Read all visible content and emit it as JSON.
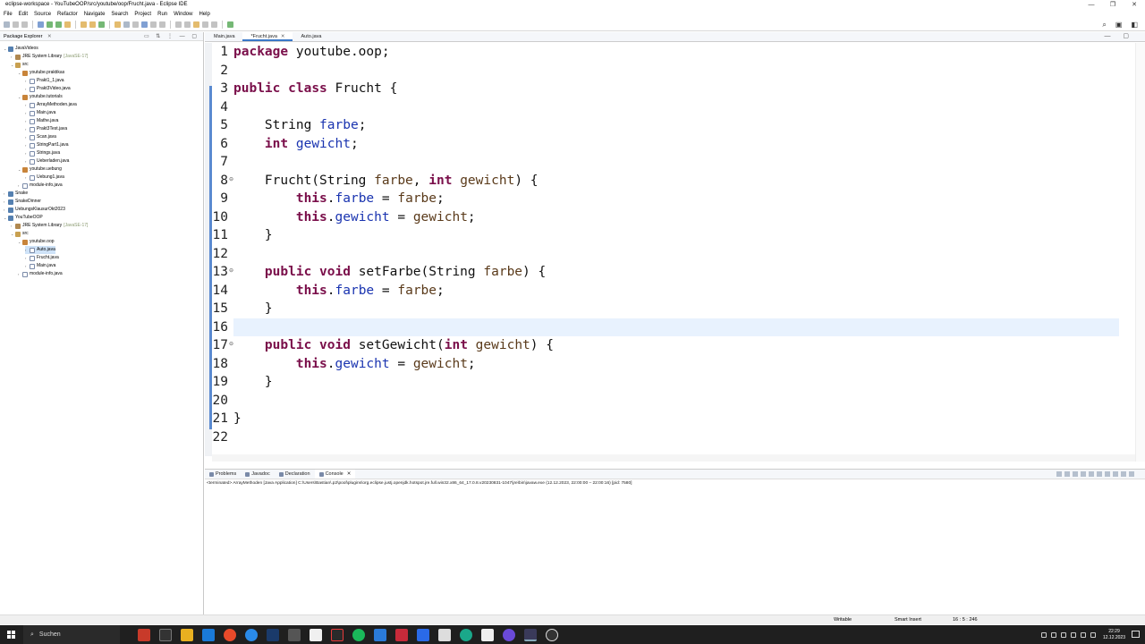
{
  "window": {
    "title": "eclipse-workspace - YouTubeOOP/src/youtube/oop/Frucht.java - Eclipse IDE"
  },
  "menu": [
    "File",
    "Edit",
    "Source",
    "Refactor",
    "Navigate",
    "Search",
    "Project",
    "Run",
    "Window",
    "Help"
  ],
  "package_explorer": {
    "title": "Package Explorer",
    "tree": [
      {
        "label": "JavaVideos",
        "depth": 0,
        "type": "proj",
        "twisty": "v"
      },
      {
        "label": "JRE System Library",
        "suffix": "[JavaSE-17]",
        "depth": 1,
        "type": "lib",
        "twisty": ">"
      },
      {
        "label": "src",
        "depth": 1,
        "type": "src",
        "twisty": "v"
      },
      {
        "label": "youtube.praktikas",
        "depth": 2,
        "type": "pkg",
        "twisty": "v"
      },
      {
        "label": "Prakt1_1.java",
        "depth": 3,
        "type": "java",
        "twisty": ">"
      },
      {
        "label": "Prakt3Video.java",
        "depth": 3,
        "type": "java",
        "twisty": ">"
      },
      {
        "label": "youtube.tutorials",
        "depth": 2,
        "type": "pkg",
        "twisty": "v"
      },
      {
        "label": "ArrayMethoden.java",
        "depth": 3,
        "type": "java",
        "twisty": ">"
      },
      {
        "label": "Main.java",
        "depth": 3,
        "type": "java",
        "twisty": ">"
      },
      {
        "label": "Mathe.java",
        "depth": 3,
        "type": "java",
        "twisty": ">"
      },
      {
        "label": "Prakt3Test.java",
        "depth": 3,
        "type": "java",
        "twisty": ">"
      },
      {
        "label": "Scan.java",
        "depth": 3,
        "type": "java",
        "twisty": ">"
      },
      {
        "label": "StringPart1.java",
        "depth": 3,
        "type": "java",
        "twisty": ">"
      },
      {
        "label": "Strings.java",
        "depth": 3,
        "type": "java",
        "twisty": ">"
      },
      {
        "label": "Ueberladen.java",
        "depth": 3,
        "type": "java",
        "twisty": ">"
      },
      {
        "label": "youtube.uebung",
        "depth": 2,
        "type": "pkg",
        "twisty": "v"
      },
      {
        "label": "Uebung1.java",
        "depth": 3,
        "type": "java",
        "twisty": ">"
      },
      {
        "label": "module-info.java",
        "depth": 2,
        "type": "java",
        "twisty": ">"
      },
      {
        "label": "Snake",
        "depth": 0,
        "type": "proj",
        "twisty": ">"
      },
      {
        "label": "SnakeDinner",
        "depth": 0,
        "type": "proj",
        "twisty": ">"
      },
      {
        "label": "UebungsKlausurOkt2023",
        "depth": 0,
        "type": "proj",
        "twisty": ">"
      },
      {
        "label": "YouTubeOOP",
        "depth": 0,
        "type": "proj",
        "twisty": "v"
      },
      {
        "label": "JRE System Library",
        "suffix": "[JavaSE-17]",
        "depth": 1,
        "type": "lib",
        "twisty": ">"
      },
      {
        "label": "src",
        "depth": 1,
        "type": "src",
        "twisty": "v"
      },
      {
        "label": "youtube.oop",
        "depth": 2,
        "type": "pkg",
        "twisty": "v"
      },
      {
        "label": "Auto.java",
        "depth": 3,
        "type": "java",
        "twisty": ">",
        "selected": true
      },
      {
        "label": "Frucht.java",
        "depth": 3,
        "type": "java",
        "twisty": ">"
      },
      {
        "label": "Main.java",
        "depth": 3,
        "type": "java",
        "twisty": ">"
      },
      {
        "label": "module-info.java",
        "depth": 2,
        "type": "java",
        "twisty": ">"
      }
    ]
  },
  "editor": {
    "tabs": [
      {
        "label": "Main.java",
        "active": false
      },
      {
        "label": "*Frucht.java",
        "active": true
      },
      {
        "label": "Auto.java",
        "active": false
      }
    ],
    "lines": [
      [
        [
          "kw",
          "package"
        ],
        [
          "t",
          " youtube.oop;"
        ]
      ],
      [],
      [
        [
          "kw",
          "public"
        ],
        [
          "t",
          " "
        ],
        [
          "kw",
          "class"
        ],
        [
          "t",
          " Frucht {"
        ]
      ],
      [],
      [
        [
          "t",
          "    String "
        ],
        [
          "fld",
          "farbe"
        ],
        [
          "t",
          ";"
        ]
      ],
      [
        [
          "t",
          "    "
        ],
        [
          "kw",
          "int"
        ],
        [
          "t",
          " "
        ],
        [
          "fld",
          "gewicht"
        ],
        [
          "t",
          ";"
        ]
      ],
      [],
      [
        [
          "t",
          "    Frucht(String "
        ],
        [
          "par",
          "farbe"
        ],
        [
          "t",
          ", "
        ],
        [
          "kw",
          "int"
        ],
        [
          "t",
          " "
        ],
        [
          "par",
          "gewicht"
        ],
        [
          "t",
          ") {"
        ]
      ],
      [
        [
          "t",
          "        "
        ],
        [
          "kw",
          "this"
        ],
        [
          "t",
          "."
        ],
        [
          "fld",
          "farbe"
        ],
        [
          "t",
          " = "
        ],
        [
          "par",
          "farbe"
        ],
        [
          "t",
          ";"
        ]
      ],
      [
        [
          "t",
          "        "
        ],
        [
          "kw",
          "this"
        ],
        [
          "t",
          "."
        ],
        [
          "fld",
          "gewicht"
        ],
        [
          "t",
          " = "
        ],
        [
          "par",
          "gewicht"
        ],
        [
          "t",
          ";"
        ]
      ],
      [
        [
          "t",
          "    }"
        ]
      ],
      [],
      [
        [
          "t",
          "    "
        ],
        [
          "kw",
          "public"
        ],
        [
          "t",
          " "
        ],
        [
          "kw",
          "void"
        ],
        [
          "t",
          " setFarbe(String "
        ],
        [
          "par",
          "farbe"
        ],
        [
          "t",
          ") {"
        ]
      ],
      [
        [
          "t",
          "        "
        ],
        [
          "kw",
          "this"
        ],
        [
          "t",
          "."
        ],
        [
          "fld",
          "farbe"
        ],
        [
          "t",
          " = "
        ],
        [
          "par",
          "farbe"
        ],
        [
          "t",
          ";"
        ]
      ],
      [
        [
          "t",
          "    }"
        ]
      ],
      [],
      [
        [
          "t",
          "    "
        ],
        [
          "kw",
          "public"
        ],
        [
          "t",
          " "
        ],
        [
          "kw",
          "void"
        ],
        [
          "t",
          " setGewicht("
        ],
        [
          "kw",
          "int"
        ],
        [
          "t",
          " "
        ],
        [
          "par",
          "gewicht"
        ],
        [
          "t",
          ") {"
        ]
      ],
      [
        [
          "t",
          "        "
        ],
        [
          "kw",
          "this"
        ],
        [
          "t",
          "."
        ],
        [
          "fld",
          "gewicht"
        ],
        [
          "t",
          " = "
        ],
        [
          "par",
          "gewicht"
        ],
        [
          "t",
          ";"
        ]
      ],
      [
        [
          "t",
          "    }"
        ]
      ],
      [],
      [
        [
          "t",
          "}"
        ]
      ],
      []
    ]
  },
  "console": {
    "tabs": [
      "Problems",
      "Javadoc",
      "Declaration",
      "Console"
    ],
    "active_tab": "Console",
    "terminated": "<terminated> ArrayMethoden [Java Application] C:\\Users\\Bastian\\.p2\\pool\\plugins\\org.eclipse.justj.openjdk.hotspot.jre.full.win32.x86_64_17.0.8.v20230831-1047\\jre\\bin\\javaw.exe  (12.12.2023, 22:00:00 – 22:00:16) [pid: 7580]"
  },
  "status": {
    "writable": "Writable",
    "insert": "Smart Insert",
    "position": "16 : 5 : 246"
  },
  "taskbar": {
    "search": "Suchen",
    "time": "22:29",
    "date": "12.12.2023"
  }
}
